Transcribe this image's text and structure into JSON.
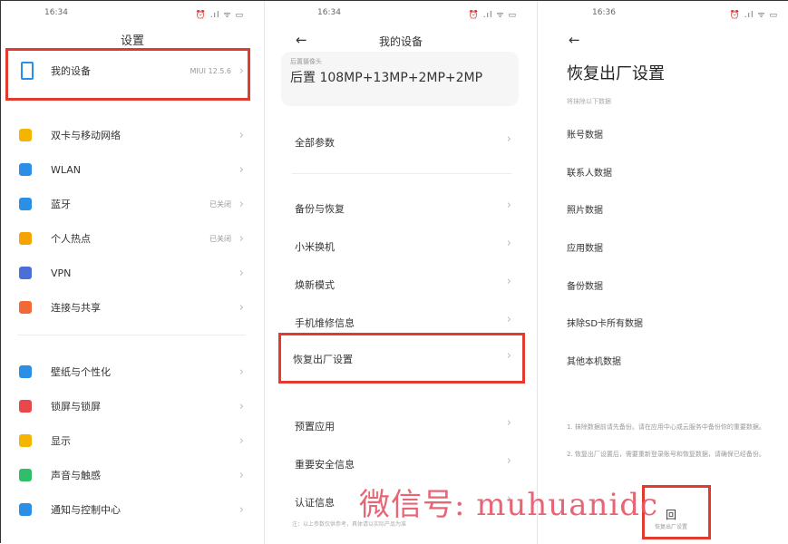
{
  "panel1": {
    "time": "16:34 ",
    "status_icons": "⏰ .ıl ᯤ ▭",
    "title": "设置",
    "my_device": {
      "label": "我的设备",
      "value": "MIUI 12.5.6"
    },
    "group1": [
      {
        "icon": "sim-card-icon",
        "color": "#f4b400",
        "label": "双卡与移动网络",
        "value": ""
      },
      {
        "icon": "wifi-icon",
        "color": "#2b8fe6",
        "label": "WLAN",
        "value": ""
      },
      {
        "icon": "bluetooth-icon",
        "color": "#2b8fe6",
        "label": "蓝牙",
        "value": "已关闭"
      },
      {
        "icon": "hotspot-icon",
        "color": "#f4a300",
        "label": "个人热点",
        "value": "已关闭"
      },
      {
        "icon": "vpn-icon",
        "color": "#4b6fd6",
        "label": "VPN",
        "value": ""
      },
      {
        "icon": "share-icon",
        "color": "#f06a35",
        "label": "连接与共享",
        "value": ""
      }
    ],
    "group2": [
      {
        "icon": "wallpaper-icon",
        "color": "#2b8fe6",
        "label": "壁纸与个性化",
        "value": ""
      },
      {
        "icon": "lock-icon",
        "color": "#e8474c",
        "label": "锁屏与锁屏",
        "value": ""
      },
      {
        "icon": "display-icon",
        "color": "#f4b400",
        "label": "显示",
        "value": ""
      },
      {
        "icon": "sound-icon",
        "color": "#2fbf6a",
        "label": "声音与触感",
        "value": ""
      },
      {
        "icon": "notification-icon",
        "color": "#2b8fe6",
        "label": "通知与控制中心",
        "value": ""
      }
    ]
  },
  "panel2": {
    "time": "16:34 ",
    "status_icons": "⏰ .ıl ᯤ ▭",
    "back": "←",
    "title": "我的设备",
    "camera_label": "后置摄像头",
    "camera_value": "后置 108MP+13MP+2MP+2MP",
    "all_params": "全部参数",
    "items": [
      "备份与恢复",
      "小米换机",
      "焕新模式",
      "手机维修信息"
    ],
    "factory_reset": "恢复出厂设置",
    "items2": [
      "预置应用",
      "重要安全信息",
      "认证信息"
    ],
    "footer": "注：以上参数仅供参考，具体请以实际产品为准"
  },
  "panel3": {
    "time": "16:36 ",
    "status_icons": "⏰ .ıl ᯤ ▭",
    "back": "←",
    "title": "恢复出厂设置",
    "subtitle": "将抹除以下数据",
    "items": [
      "账号数据",
      "联系人数据",
      "照片数据",
      "应用数据",
      "备份数据",
      "抹除SD卡所有数据",
      "其他本机数据"
    ],
    "note1": "1. 抹除数据前请先备份。请在应用中心或云服务中备份你的重要数据。",
    "note2": "2. 恢复出厂设置后，需要重新登录账号和恢复数据，请确保已经备份。",
    "reset_glyph": "回",
    "reset_caption": "恢复出厂设置"
  },
  "watermark": "微信号: muhuanidc"
}
